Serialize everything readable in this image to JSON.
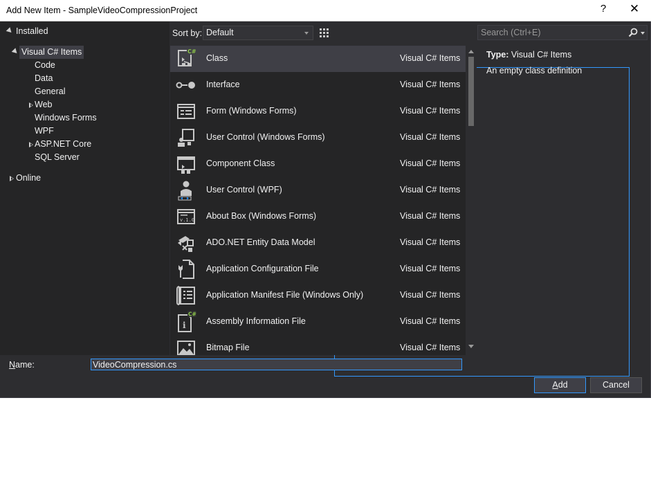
{
  "window": {
    "title": "Add New Item - SampleVideoCompressionProject",
    "help_glyph": "?",
    "close_glyph": "✕"
  },
  "tree": {
    "installed": "Installed",
    "visual_csharp_items": "Visual C# Items",
    "children": [
      "Code",
      "Data",
      "General",
      "Web",
      "Windows Forms",
      "WPF",
      "ASP.NET Core",
      "SQL Server"
    ],
    "online": "Online"
  },
  "sort": {
    "label": "Sort by:",
    "value": "Default"
  },
  "search": {
    "placeholder": "Search (Ctrl+E)"
  },
  "items": [
    {
      "name": "Class",
      "category": "Visual C# Items",
      "icon": "class-icon",
      "selected": true
    },
    {
      "name": "Interface",
      "category": "Visual C# Items",
      "icon": "interface-icon"
    },
    {
      "name": "Form (Windows Forms)",
      "category": "Visual C# Items",
      "icon": "form-icon"
    },
    {
      "name": "User Control (Windows Forms)",
      "category": "Visual C# Items",
      "icon": "user-control-icon"
    },
    {
      "name": "Component Class",
      "category": "Visual C# Items",
      "icon": "component-icon"
    },
    {
      "name": "User Control (WPF)",
      "category": "Visual C# Items",
      "icon": "wpf-user-control-icon"
    },
    {
      "name": "About Box (Windows Forms)",
      "category": "Visual C# Items",
      "icon": "about-box-icon"
    },
    {
      "name": "ADO.NET Entity Data Model",
      "category": "Visual C# Items",
      "icon": "entity-model-icon"
    },
    {
      "name": "Application Configuration File",
      "category": "Visual C# Items",
      "icon": "config-file-icon"
    },
    {
      "name": "Application Manifest File (Windows Only)",
      "category": "Visual C# Items",
      "icon": "manifest-file-icon"
    },
    {
      "name": "Assembly Information File",
      "category": "Visual C# Items",
      "icon": "assembly-info-icon"
    },
    {
      "name": "Bitmap File",
      "category": "Visual C# Items",
      "icon": "bitmap-icon"
    }
  ],
  "details": {
    "type_label": "Type:",
    "type_value": "Visual C# Items",
    "description": "An empty class definition"
  },
  "name_field": {
    "label_first": "N",
    "label_rest": "ame:",
    "value": "VideoCompression.cs"
  },
  "buttons": {
    "add_first": "A",
    "add_rest": "dd",
    "cancel": "Cancel"
  },
  "colors": {
    "background": "#2d2d30",
    "panel": "#252526",
    "selection": "#3f3f46",
    "accent": "#3399ff",
    "text": "#f1f1f1"
  }
}
